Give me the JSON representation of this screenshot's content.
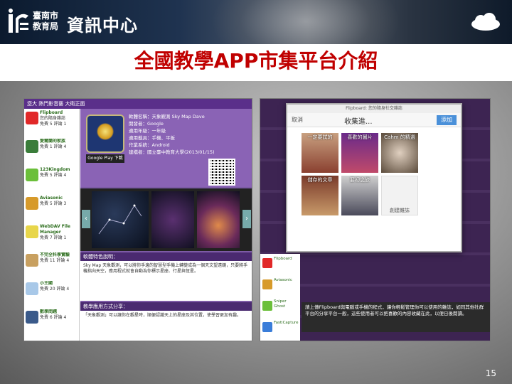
{
  "header": {
    "org_line1": "臺南市",
    "org_line2": "教育局",
    "center_name": "資訊中心"
  },
  "slide": {
    "title": "全國教學APP市集平台介紹",
    "page_number": "15"
  },
  "left_screenshot": {
    "top_bar": "您大 熱門影音藝 大衛正面",
    "sidebar_items": [
      {
        "name": "Flipboard",
        "desc": "您的隨身雜誌",
        "meta": "免費 5 評論 1"
      },
      {
        "name": "愛爾蘭的家族",
        "desc": "",
        "meta": "免費 1 評論 4"
      },
      {
        "name": "123Kingdom",
        "desc": "",
        "meta": "免費 5 評論 4"
      },
      {
        "name": "Aviasonic",
        "desc": "",
        "meta": "免費 5 評論 3"
      },
      {
        "name": "WebDAV File Manager",
        "desc": "",
        "meta": "免費 7 評論 1"
      },
      {
        "name": "不完全科學實驗",
        "desc": "",
        "meta": "免費 11 評論 4"
      },
      {
        "name": "小王國",
        "desc": "",
        "meta": "免費 20 評論 4"
      },
      {
        "name": "數學問題",
        "desc": "",
        "meta": "免費 6 評論 4"
      }
    ],
    "app": {
      "badge": "Google Play 下載",
      "info_lines": [
        "軟體名稱：天象觀測 Sky Map Dave",
        "開發者：Google",
        "適用年級：一年級",
        "適用載具：手機、平板",
        "作業系統：Android",
        "建檔者：國立臺中教育大學(2013/01/15)"
      ]
    },
    "section1_title": "軟體特色說明：",
    "section1_text": "Sky Map 天象觀測，可以將你手邊的智慧型手機上轉變成為一個天文望遠鏡，只要將手機指向天空，應用程式就會自動為你標示星座、行星與恆星。",
    "section2_title": "教學應用方式分享：",
    "section2_text": "「天象觀測」可以讓你在觀星時，順便認識天上的星座及其位置，使學習更加有趣。"
  },
  "right_screenshot": {
    "dialog_title": "Flipboard: 您的隨身社交雜誌",
    "cancel_label": "取消",
    "dialog_heading": "收集進...",
    "add_label": "添加",
    "tiles": [
      "一定要試的",
      "喜歡的圖片",
      "Cahm 的精選",
      "儲存的文章",
      "要初之旅",
      "創建雜誌"
    ],
    "sidebar_items": [
      "Flipboard",
      "Aviasonic",
      "Sniper Ghost",
      "FastiCapture"
    ],
    "tip_text": "請上傳Flipboard與電腦或手機的程式，讓你輕鬆管理你可以使用的雜誌，如同其他社群平台的分享平台一般，這些使用者可以把喜歡的內容收藏在此，以便日後閱讀。"
  },
  "colors": {
    "title_red": "#c00000",
    "purple": "#7d5ba6",
    "dark_purple": "#4a2a70"
  }
}
